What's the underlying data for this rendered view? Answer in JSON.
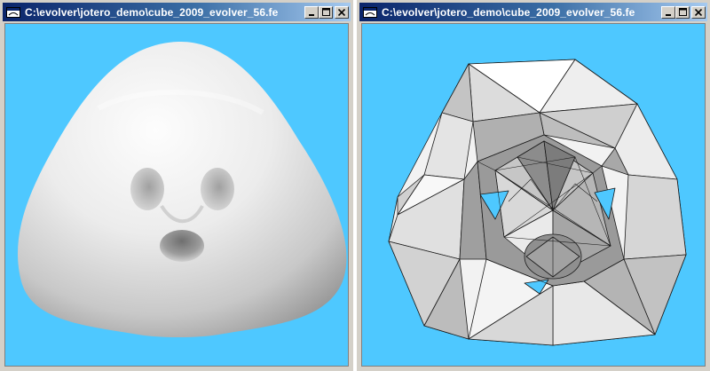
{
  "windows": [
    {
      "title": "C:\\evolver\\jotero_demo\\cube_2009_evolver_56.fe",
      "view": "smooth-shaded surface",
      "controls": [
        "minimize-icon",
        "maximize-icon",
        "close-icon"
      ]
    },
    {
      "title": "C:\\evolver\\jotero_demo\\cube_2009_evolver_56.fe",
      "view": "triangulated mesh",
      "controls": [
        "minimize-icon",
        "maximize-icon",
        "close-icon"
      ]
    }
  ],
  "colors": {
    "titlebar": "#0a246a",
    "canvas": "#4ec8ff",
    "surface": "#e6e6e6",
    "window": "#d4d0c8"
  }
}
